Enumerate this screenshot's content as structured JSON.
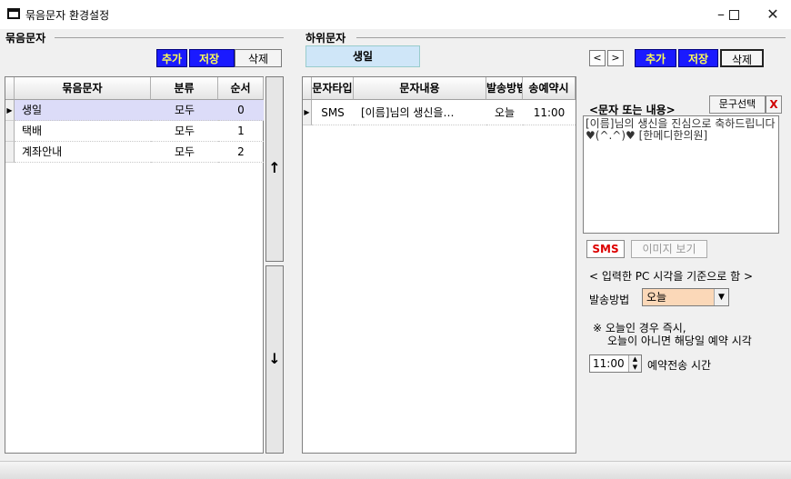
{
  "window": {
    "title": "묶음문자 환경설정",
    "minimize": "–",
    "close": "✕"
  },
  "left_group": {
    "label": "묶음문자",
    "add_label": "추가",
    "save_label": "저장",
    "delete_label": "삭제",
    "columns": [
      "묶음문자",
      "분류",
      "순서"
    ],
    "rows": [
      {
        "name": "생일",
        "category": "모두",
        "order": "0"
      },
      {
        "name": "택배",
        "category": "모두",
        "order": "1"
      },
      {
        "name": "계좌안내",
        "category": "모두",
        "order": "2"
      }
    ],
    "up_arrow": "↑",
    "down_arrow": "↓"
  },
  "right_group": {
    "label": "하위문자",
    "selected_tab": "생일",
    "nav_prev": "<",
    "nav_next": ">",
    "add_label": "추가",
    "save_label": "저장",
    "delete_label": "삭제",
    "columns": [
      "문자타입",
      "문자내용",
      "발송방법",
      "송예약시"
    ],
    "rows": [
      {
        "type": "SMS",
        "content": "[이름]님의 생신을…",
        "method": "오늘",
        "time": "11:00"
      }
    ]
  },
  "detail": {
    "content_label": "<문자 또는 내용>",
    "phrase_select_label": "문구선택",
    "phrase_delete_label": "X",
    "message_text": "[이름]님의 생신을 진심으로 축하드립니다♥(^.^)♥ [한메디한의원]",
    "sms_label": "SMS",
    "image_view_label": "이미지 보기",
    "pc_time_note": "< 입력한 PC 시각을 기준으로 함 >",
    "send_method_label": "발송방법",
    "send_method_value": "오늘",
    "note_line1": "※ 오늘인 경우 즉시,",
    "note_line2": "오늘이 아니면 해당일 예약 시각",
    "time_value": "11:00",
    "time_label": "예약전송 시간"
  }
}
